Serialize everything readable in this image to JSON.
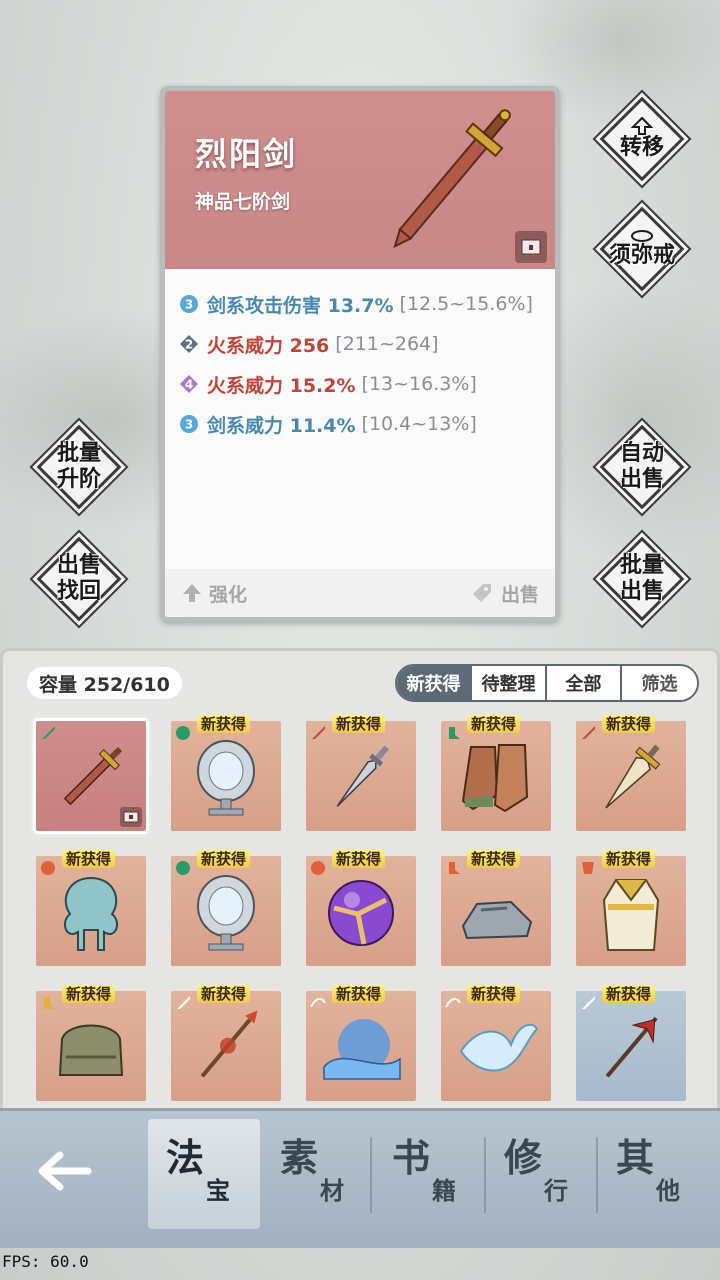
{
  "item_detail": {
    "name": "烈阳剑",
    "grade": "神品七阶剑",
    "stats": [
      {
        "level": "3",
        "gem_color": "#5aa8d8",
        "name": "剑系攻击伤害 13.7%",
        "range": "[12.5~15.6%]"
      },
      {
        "level": "2",
        "gem_color": "#5d6f82",
        "name": "火系威力 256",
        "range": "[211~264]"
      },
      {
        "level": "4",
        "gem_color": "#a57ad0",
        "name": "火系威力 15.2%",
        "range": "[13~16.3%]"
      },
      {
        "level": "3",
        "gem_color": "#5aa8d8",
        "name": "剑系威力 11.4%",
        "range": "[10.4~13%]"
      }
    ],
    "enhance_label": "强化",
    "sell_label": "出售"
  },
  "side_buttons": {
    "transfer": "转移",
    "ring": "须弥戒",
    "batch_upgrade_1": "批量",
    "batch_upgrade_2": "升阶",
    "sell_recover_1": "出售",
    "sell_recover_2": "找回",
    "auto_sell_1": "自动",
    "auto_sell_2": "出售",
    "batch_sell_1": "批量",
    "batch_sell_2": "出售"
  },
  "inventory": {
    "capacity": "容量 252/610",
    "tabs": [
      "新获得",
      "待整理",
      "全部",
      "筛选"
    ],
    "new_badge": "新获得",
    "items": [
      {
        "kind": "sword",
        "bg": "pink",
        "new": false,
        "selected": true
      },
      {
        "kind": "mirror",
        "bg": "tan",
        "new": true
      },
      {
        "kind": "blade",
        "bg": "tan",
        "new": true
      },
      {
        "kind": "boots",
        "bg": "tan",
        "new": true
      },
      {
        "kind": "greatsword",
        "bg": "tan",
        "new": true
      },
      {
        "kind": "amulet",
        "bg": "tan",
        "new": true
      },
      {
        "kind": "mirror",
        "bg": "tan",
        "new": true
      },
      {
        "kind": "orb",
        "bg": "tan",
        "new": true
      },
      {
        "kind": "shoes",
        "bg": "tan",
        "new": true
      },
      {
        "kind": "robe",
        "bg": "tan",
        "new": true
      },
      {
        "kind": "helm",
        "bg": "tan",
        "new": true
      },
      {
        "kind": "spear",
        "bg": "tan",
        "new": true
      },
      {
        "kind": "frost-orb",
        "bg": "tan",
        "new": true
      },
      {
        "kind": "frost-bird",
        "bg": "tan",
        "new": true
      },
      {
        "kind": "halberd",
        "bg": "blue",
        "new": true
      }
    ]
  },
  "nav": {
    "tabs": [
      {
        "big": "法",
        "small": "宝"
      },
      {
        "big": "素",
        "small": "材"
      },
      {
        "big": "书",
        "small": "籍"
      },
      {
        "big": "修",
        "small": "行"
      },
      {
        "big": "其",
        "small": "他"
      }
    ]
  },
  "fps": "FPS: 60.0"
}
